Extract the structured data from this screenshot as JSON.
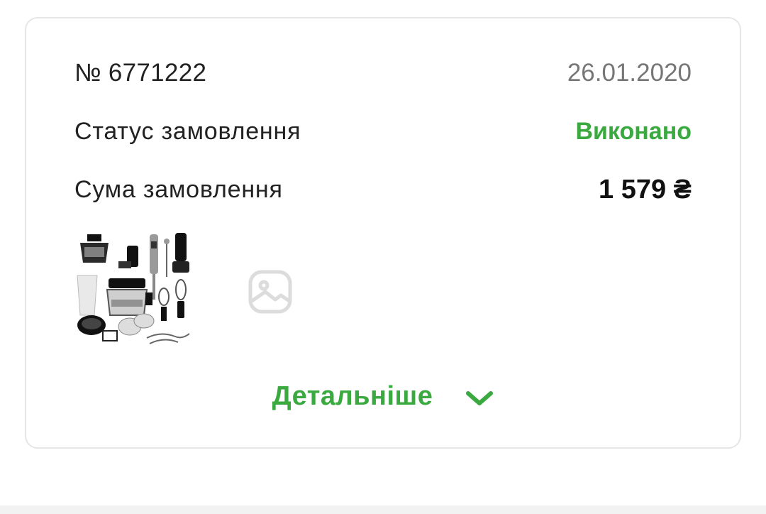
{
  "order": {
    "number": "№ 6771222",
    "date": "26.01.2020",
    "status_label": "Статус замовлення",
    "status_value": "Виконано",
    "sum_label": "Сума замовлення",
    "sum_value": "1 579 ₴",
    "details_label": "Детальніше"
  },
  "colors": {
    "accent_green": "#3aa93f",
    "date_gray": "#767676",
    "card_border": "#e6e6e6"
  },
  "icons": {
    "product_thumbnail": "blender-kit-image",
    "image_placeholder": "image-placeholder-icon",
    "expand": "chevron-down-icon"
  }
}
